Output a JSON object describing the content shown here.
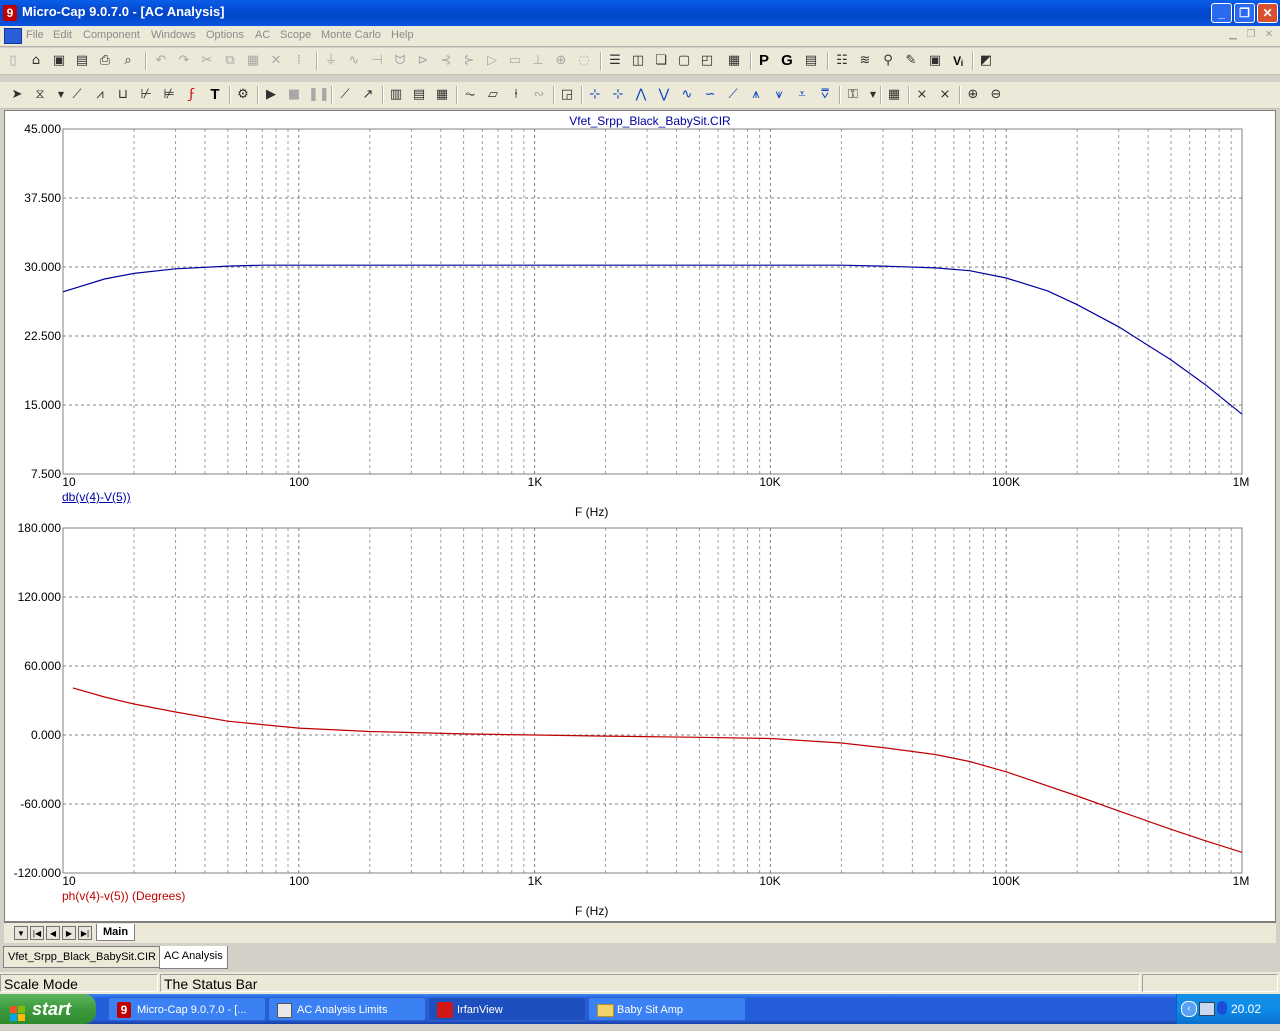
{
  "window": {
    "title": "Micro-Cap 9.0.7.0 - [AC Analysis]",
    "controls": {
      "minimize": "_",
      "restore": "❐",
      "close": "✕"
    }
  },
  "menu": [
    "File",
    "Edit",
    "Component",
    "Windows",
    "Options",
    "AC",
    "Scope",
    "Monte Carlo",
    "Help"
  ],
  "toolbar_text": {
    "probe_p": "P",
    "probe_g": "G",
    "vb": "Vᵢ",
    "text_tool": "T"
  },
  "colors": {
    "blue_trace": "#0000a0",
    "red_trace": "#c00000",
    "grid": "#a0a0a0"
  },
  "plot": {
    "title": "Vfet_Srpp_Black_BabySit.CIR",
    "top": {
      "y_ticks": [
        "45.000",
        "37.500",
        "30.000",
        "22.500",
        "15.000",
        "7.500"
      ],
      "expr": "db(v(4)-V(5))",
      "xlabel": "F (Hz)"
    },
    "bottom": {
      "y_ticks": [
        "180.000",
        "120.000",
        "60.000",
        "0.000",
        "-60.000",
        "-120.000"
      ],
      "expr": "ph(v(4)-v(5)) (Degrees)",
      "xlabel": "F (Hz)"
    },
    "x_ticks": [
      "10",
      "100",
      "1K",
      "10K",
      "100K",
      "1M"
    ]
  },
  "chart_data": [
    {
      "type": "line",
      "xscale": "log",
      "xlim": [
        10,
        1000000
      ],
      "ylim": [
        7.5,
        45
      ],
      "xlabel": "F (Hz)",
      "ylabel": "db(v(4)-V(5))",
      "grid": true,
      "series": [
        {
          "name": "db(v(4)-V(5))",
          "x": [
            10,
            15,
            20,
            30,
            50,
            70,
            100,
            200,
            500,
            1000,
            5000,
            10000,
            20000,
            30000,
            50000,
            70000,
            100000,
            150000,
            200000,
            300000,
            500000,
            700000,
            1000000
          ],
          "y": [
            27.3,
            28.7,
            29.3,
            29.8,
            30.1,
            30.2,
            30.2,
            30.2,
            30.2,
            30.2,
            30.2,
            30.2,
            30.2,
            30.1,
            29.9,
            29.6,
            28.8,
            27.4,
            25.9,
            23.5,
            19.9,
            17.2,
            14.0
          ]
        }
      ]
    },
    {
      "type": "line",
      "xscale": "log",
      "xlim": [
        10,
        1000000
      ],
      "ylim": [
        -120,
        180
      ],
      "xlabel": "F (Hz)",
      "ylabel": "ph(v(4)-v(5)) (Degrees)",
      "grid": true,
      "series": [
        {
          "name": "ph(v(4)-v(5)) (Degrees)",
          "x": [
            11,
            15,
            20,
            30,
            50,
            70,
            100,
            200,
            500,
            1000,
            2000,
            5000,
            10000,
            20000,
            30000,
            50000,
            70000,
            100000,
            200000,
            300000,
            500000,
            700000,
            1000000
          ],
          "y": [
            41,
            33,
            27,
            20,
            12,
            9,
            6,
            3,
            1,
            0,
            -1,
            -2,
            -3,
            -7,
            -11,
            -17,
            -23,
            -32,
            -53,
            -66,
            -82,
            -92,
            -102
          ]
        }
      ]
    }
  ],
  "sheet_tab": "Main",
  "doc_tabs": [
    "Vfet_Srpp_Black_BabySit.CIR",
    "AC Analysis"
  ],
  "status": {
    "mode": "Scale Mode",
    "message": "The Status Bar"
  },
  "taskbar": {
    "start": "start",
    "items": [
      "Micro-Cap 9.0.7.0 - [...",
      "AC Analysis Limits",
      "IrfanView",
      "Baby Sit Amp"
    ],
    "clock": "20.02"
  }
}
